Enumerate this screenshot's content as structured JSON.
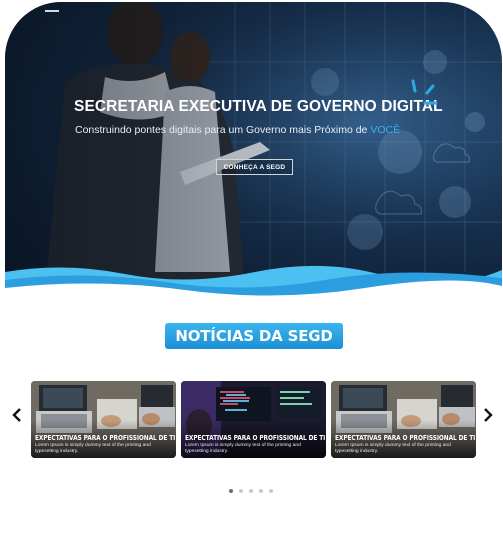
{
  "hero": {
    "title": "SECRETARIA EXECUTIVA DE GOVERNO DIGITAL",
    "subtitle_main": "Construindo pontes digitais para um Governo mais Próximo de ",
    "subtitle_accent": "VOCÊ",
    "cta_label": "CONHEÇA A SEGD"
  },
  "news": {
    "heading": "NOTÍCIAS DA SEGD",
    "cards": [
      {
        "title": "EXPECTATIVAS PARA O PROFISSIONAL DE TI",
        "text": "Lorem Ipsum is simply dummy text of the printing and typesetting industry."
      },
      {
        "title": "EXPECTATIVAS PARA O PROFISSIONAL DE TI",
        "text": "Lorem Ipsum is simply dummy text of the printing and typesetting industry."
      },
      {
        "title": "EXPECTATIVAS PARA O PROFISSIONAL DE TI",
        "text": "Lorem Ipsum is simply dummy text of the printing and typesetting industry."
      }
    ],
    "pagination": {
      "count": 5,
      "active": 1
    }
  },
  "colors": {
    "accent": "#34b1ee",
    "heading_bg": "#2a9fe0",
    "hero_dark": "#0f2238"
  },
  "icons": [
    "brand-logo-icon",
    "chevron-left-icon",
    "chevron-right-icon"
  ]
}
